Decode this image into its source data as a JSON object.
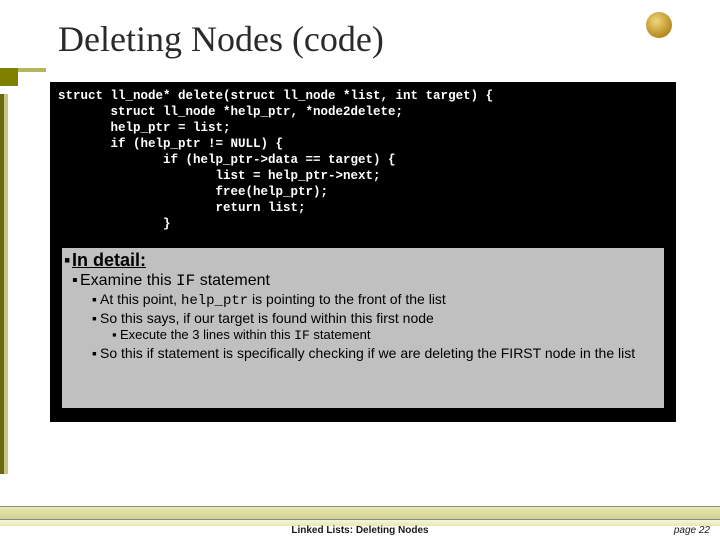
{
  "title": "Deleting Nodes (code)",
  "code": "struct ll_node* delete(struct ll_node *list, int target) {\n       struct ll_node *help_ptr, *node2delete;\n       help_ptr = list;\n       if (help_ptr != NULL) {\n              if (help_ptr->data == target) {\n                     list = help_ptr->next;\n                     free(help_ptr);\n                     return list;\n              }",
  "detail": {
    "heading": "In detail:",
    "line1_a": "Examine this ",
    "line1_code": "IF",
    "line1_b": " statement",
    "line2_a": "At this point, ",
    "line2_code": "help_ptr",
    "line2_b": " is pointing to the front of the list",
    "line3": "So this says, if our target is found within this first node",
    "line4_a": "Execute the 3 lines within this ",
    "line4_code": "IF",
    "line4_b": " statement",
    "line5": "So this if statement is specifically checking if we are deleting the FIRST node in the list"
  },
  "footer": "Linked Lists:  Deleting Nodes",
  "page": "page 22"
}
